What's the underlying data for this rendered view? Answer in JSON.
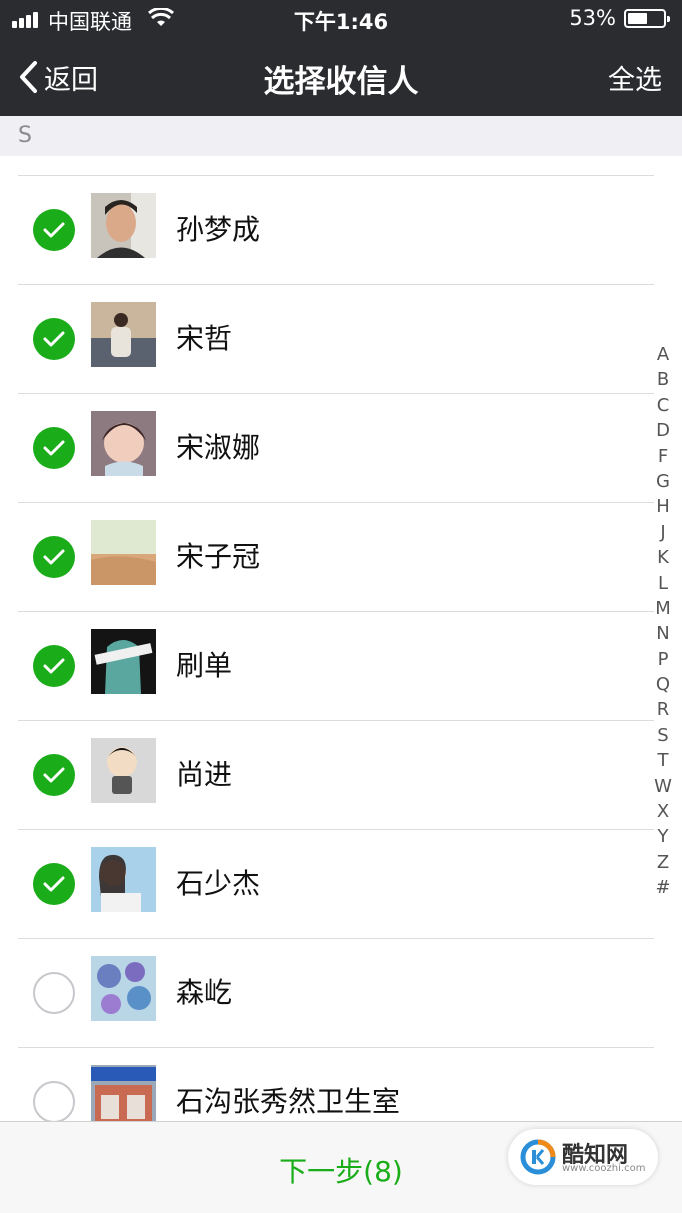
{
  "status": {
    "carrier": "中国联通",
    "time": "下午1:46",
    "battery": "53%",
    "battery_level": 0.53
  },
  "nav": {
    "back_label": "返回",
    "title": "选择收信人",
    "select_all": "全选"
  },
  "section_letter": "S",
  "contacts": [
    {
      "name": "孙梦成",
      "checked": true
    },
    {
      "name": "宋哲",
      "checked": true
    },
    {
      "name": "宋淑娜",
      "checked": true
    },
    {
      "name": "宋子冠",
      "checked": true
    },
    {
      "name": "刷单",
      "checked": true
    },
    {
      "name": "尚进",
      "checked": true
    },
    {
      "name": "石少杰",
      "checked": true
    },
    {
      "name": "森屹",
      "checked": false
    },
    {
      "name": "石沟张秀然卫生室",
      "checked": false
    }
  ],
  "index_letters": [
    "A",
    "B",
    "C",
    "D",
    "F",
    "G",
    "H",
    "J",
    "K",
    "L",
    "M",
    "N",
    "P",
    "Q",
    "R",
    "S",
    "T",
    "W",
    "X",
    "Y",
    "Z",
    "#"
  ],
  "bottom": {
    "next_label": "下一步(8)"
  },
  "watermark": {
    "name": "酷知网",
    "url": "www.coozhi.com"
  },
  "colors": {
    "accent": "#1aad19",
    "navbar": "#2b2c30"
  }
}
